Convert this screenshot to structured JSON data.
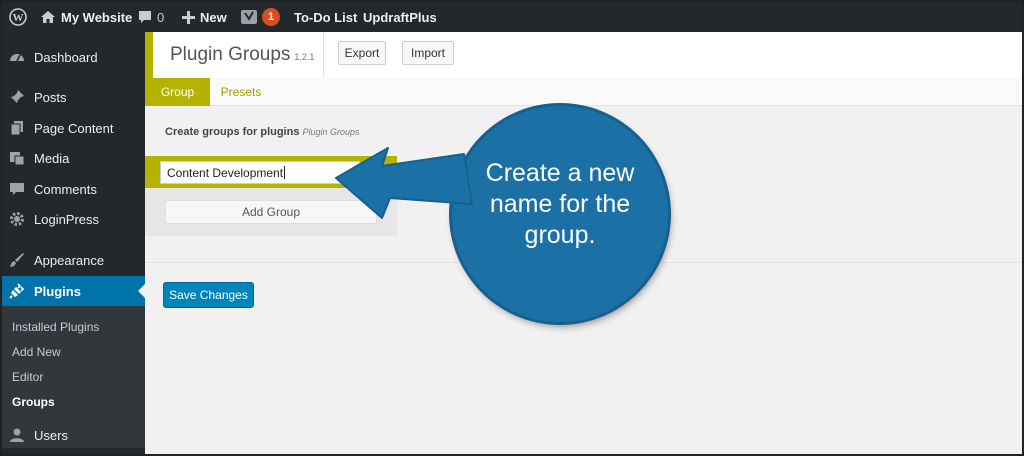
{
  "admin_bar": {
    "site_name": "My Website",
    "comments_count": "0",
    "new_label": "New",
    "yoast_badge": "1",
    "todo_label": "To-Do List",
    "updraft_label": "UpdraftPlus"
  },
  "sidebar": {
    "items": [
      {
        "label": "Dashboard",
        "icon": "dashboard-icon"
      },
      {
        "label": "Posts",
        "icon": "pin-icon"
      },
      {
        "label": "Page Content",
        "icon": "pages-icon"
      },
      {
        "label": "Media",
        "icon": "media-icon"
      },
      {
        "label": "Comments",
        "icon": "comment-icon"
      },
      {
        "label": "LoginPress",
        "icon": "gear-icon"
      },
      {
        "label": "Appearance",
        "icon": "brush-icon"
      },
      {
        "label": "Plugins",
        "icon": "plugin-icon"
      },
      {
        "label": "Users",
        "icon": "user-icon"
      }
    ],
    "submenu": [
      "Installed Plugins",
      "Add New",
      "Editor",
      "Groups"
    ]
  },
  "page": {
    "title": "Plugin Groups",
    "version": "1.2.1",
    "export_label": "Export",
    "import_label": "Import",
    "tabs": [
      "Group",
      "Presets"
    ],
    "section_label": "Create groups for plugins",
    "section_sublabel": "Plugin Groups",
    "group_input_value": "Content Development",
    "add_group_label": "Add Group",
    "save_label": "Save Changes"
  },
  "callout": {
    "text": "Create a new name for the group."
  },
  "colors": {
    "admin_bg": "#23282d",
    "accent_olive": "#b4b400",
    "wp_blue": "#0073aa",
    "callout_blue": "#1b71a6"
  }
}
